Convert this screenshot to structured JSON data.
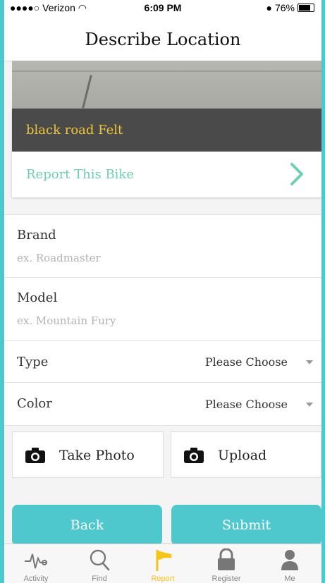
{
  "status_bar": {
    "carrier": "●●●●○ Verizon",
    "time": "6:09 PM",
    "battery": "76%",
    "battery_level": 0.76
  },
  "nav": {
    "title": "Describe Location"
  },
  "bike_card": {
    "name": "black road Felt",
    "report_label": "Report This Bike"
  },
  "form": {
    "brand": {
      "label": "Brand",
      "placeholder": "ex. Roadmaster"
    },
    "model": {
      "label": "Model",
      "placeholder": "ex. Mountain Fury"
    },
    "type": {
      "label": "Type",
      "value": "Please Choose"
    },
    "color": {
      "label": "Color",
      "value": "Please Choose"
    }
  },
  "photo_buttons": {
    "take_photo": "Take Photo",
    "upload": "Upload"
  },
  "actions": {
    "back": "Back",
    "submit": "Submit"
  },
  "tabs": [
    {
      "label": "Activity",
      "icon": "activity-icon"
    },
    {
      "label": "Find",
      "icon": "search-icon"
    },
    {
      "label": "Report",
      "icon": "flag-icon",
      "active": true
    },
    {
      "label": "Register",
      "icon": "lock-icon"
    },
    {
      "label": "Me",
      "icon": "person-icon"
    }
  ],
  "colors": {
    "accent": "#4ec8cc",
    "bike_name": "#f0c43a",
    "report_link": "#6fcfb3",
    "active_tab": "#f5c518"
  }
}
